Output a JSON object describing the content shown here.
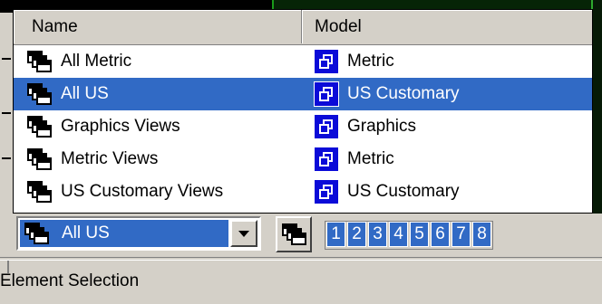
{
  "list": {
    "columns": {
      "name": "Name",
      "model": "Model"
    },
    "rows": [
      {
        "name": "All Metric",
        "model": "Metric",
        "selected": false
      },
      {
        "name": "All US",
        "model": "US Customary",
        "selected": true
      },
      {
        "name": "Graphics Views",
        "model": "Graphics",
        "selected": false
      },
      {
        "name": "Metric Views",
        "model": "Metric",
        "selected": false
      },
      {
        "name": "US Customary Views",
        "model": "US Customary",
        "selected": false
      }
    ]
  },
  "toolbar": {
    "combo_value": "All US",
    "view_numbers": [
      "1",
      "2",
      "3",
      "4",
      "5",
      "6",
      "7",
      "8"
    ]
  },
  "status": {
    "label": "Element Selection"
  },
  "icons": {
    "row_icon": "layered-windows-icon",
    "model_icon": "model-icon",
    "dropdown": "chevron-down-icon"
  },
  "colors": {
    "selection": "#316ac5",
    "model_icon": "#0b0bd8",
    "chrome": "#d4d0c8"
  }
}
